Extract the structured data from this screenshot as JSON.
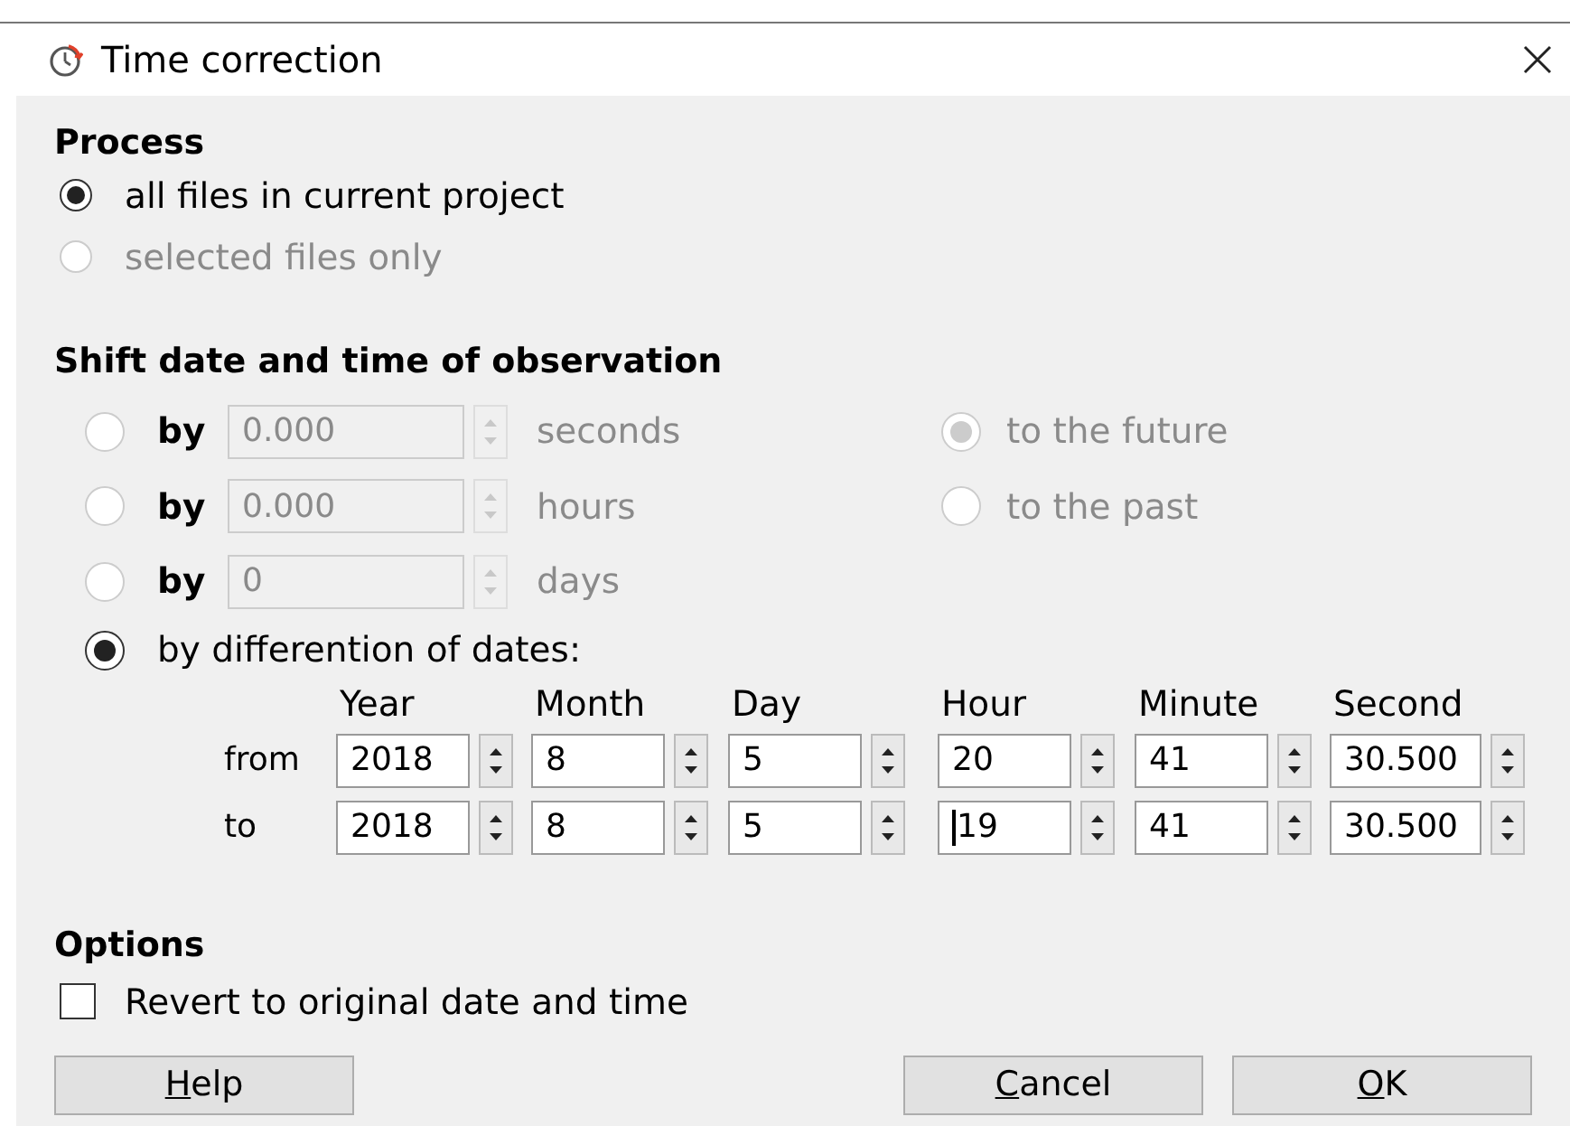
{
  "window": {
    "title": "Time correction"
  },
  "process": {
    "heading": "Process",
    "options": [
      {
        "label": "all files in current project",
        "selected": true,
        "disabled": false
      },
      {
        "label": "selected files only",
        "selected": false,
        "disabled": true
      }
    ]
  },
  "shift": {
    "heading": "Shift date and time of observation",
    "modes": [
      {
        "kind": "amount",
        "label": "by",
        "value": "0.000",
        "unit": "seconds",
        "selected": false,
        "disabled": true
      },
      {
        "kind": "amount",
        "label": "by",
        "value": "0.000",
        "unit": "hours",
        "selected": false,
        "disabled": true
      },
      {
        "kind": "amount",
        "label": "by",
        "value": "0",
        "unit": "days",
        "selected": false,
        "disabled": true
      },
      {
        "kind": "dates",
        "label": "by differention of dates:",
        "selected": true,
        "disabled": false
      }
    ],
    "direction": [
      {
        "label": "to the future",
        "selected": true,
        "disabled": true
      },
      {
        "label": "to the past",
        "selected": false,
        "disabled": true
      }
    ],
    "dates": {
      "columns": [
        "Year",
        "Month",
        "Day",
        "Hour",
        "Minute",
        "Second"
      ],
      "rows": [
        {
          "label": "from",
          "values": [
            {
              "value": "2018",
              "focused": false
            },
            {
              "value": "8",
              "focused": false
            },
            {
              "value": "5",
              "focused": false
            },
            {
              "value": "20",
              "focused": false
            },
            {
              "value": "41",
              "focused": false
            },
            {
              "value": "30.500",
              "focused": false
            }
          ]
        },
        {
          "label": "to",
          "values": [
            {
              "value": "2018",
              "focused": false
            },
            {
              "value": "8",
              "focused": false
            },
            {
              "value": "5",
              "focused": false
            },
            {
              "value": "19",
              "focused": true
            },
            {
              "value": "41",
              "focused": false
            },
            {
              "value": "30.500",
              "focused": false
            }
          ]
        }
      ]
    }
  },
  "options": {
    "heading": "Options",
    "items": [
      {
        "label": "Revert to original date and time",
        "checked": false
      }
    ]
  },
  "buttons": [
    {
      "label_parts": [
        {
          "text": "H",
          "underlined": true
        },
        {
          "text": "elp",
          "underlined": false
        }
      ]
    },
    {
      "label_parts": [
        {
          "text": "C",
          "underlined": true
        },
        {
          "text": "ancel",
          "underlined": false
        }
      ]
    },
    {
      "label_parts": [
        {
          "text": "O",
          "underlined": true
        },
        {
          "text": "K",
          "underlined": false
        }
      ]
    }
  ]
}
